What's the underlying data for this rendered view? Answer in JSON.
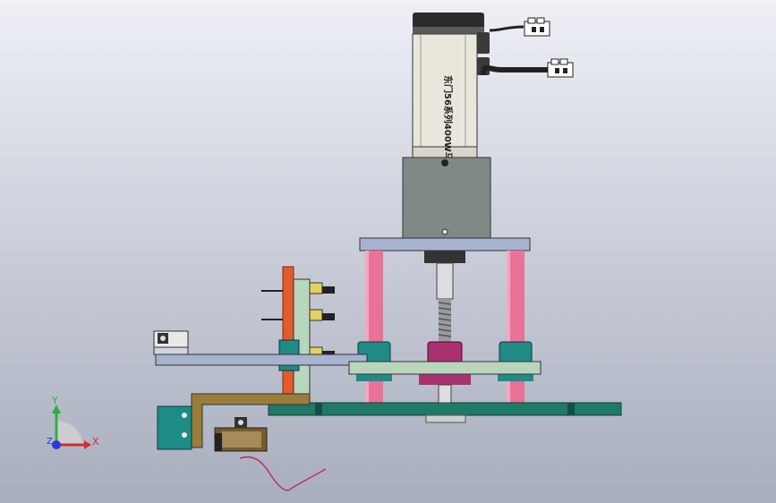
{
  "viewport": {
    "background_top": "#eef0f6",
    "background_bottom": "#a9aebd"
  },
  "motor": {
    "label": "东门56系列400W马达",
    "body_color": "#e9e6dc",
    "cap_color": "#2c2c2c"
  },
  "connectors": {
    "color": "#ffffff"
  },
  "colors": {
    "gearbox": "#7f8a86",
    "plate": "#a7b3cf",
    "green_plate": "#b9d6bd",
    "pink_column": "#ea7198",
    "teal": "#1f8b84",
    "magenta": "#a83270",
    "base": "#1f7a68",
    "orange": "#e55a2a",
    "bracket_brown": "#9a7d3a",
    "block_teal": "#1c8c84",
    "wire": "#c03060"
  },
  "triad": {
    "x_label": "X",
    "y_label": "Y",
    "z_label": "Z",
    "x_color": "#d42d2d",
    "y_color": "#2fae3b",
    "z_color": "#2a3cd8"
  }
}
